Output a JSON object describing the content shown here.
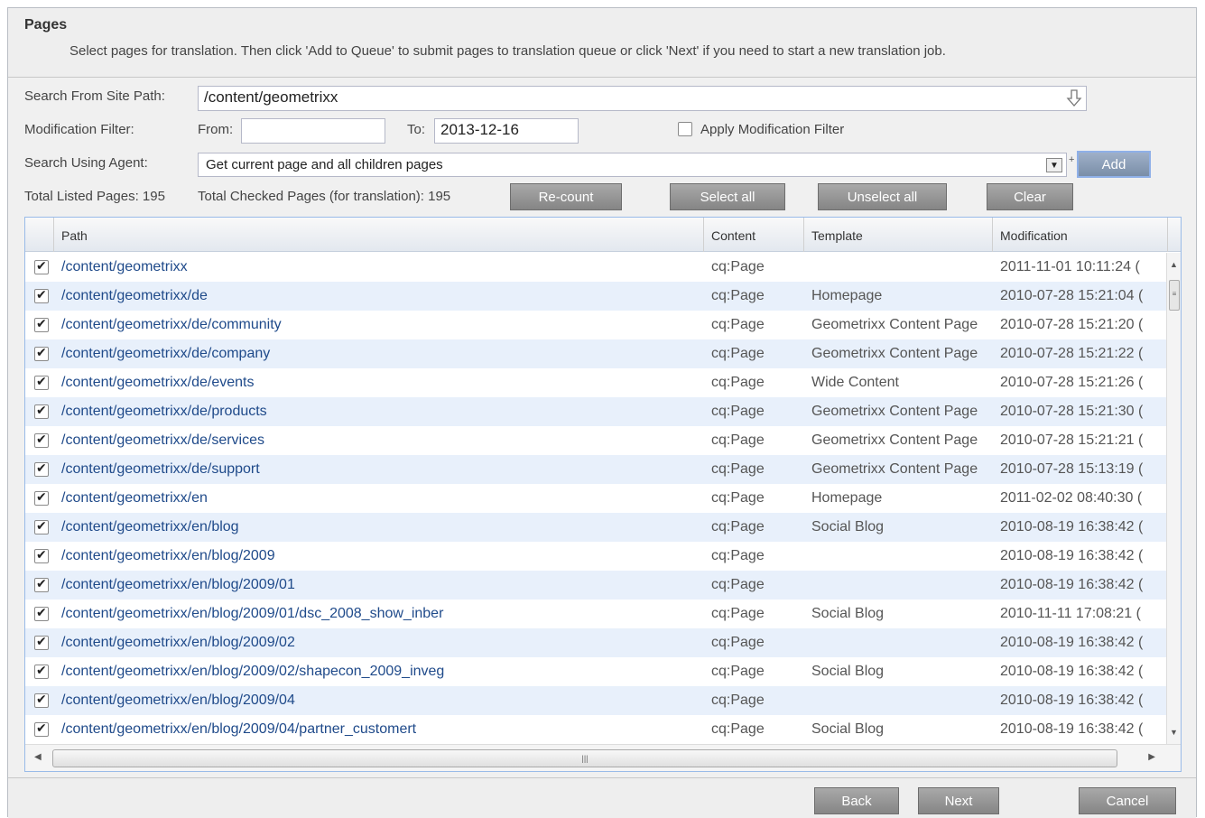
{
  "panel": {
    "title": "Pages",
    "description": "Select pages for translation. Then click 'Add to Queue' to submit pages to translation queue or click 'Next' if you need to start a new translation job."
  },
  "form": {
    "site_path_label": "Search From Site Path:",
    "site_path_value": "/content/geometrixx",
    "mod_filter_label": "Modification Filter:",
    "from_label": "From:",
    "from_value": "",
    "to_label": "To:",
    "to_value": "2013-12-16",
    "apply_filter_label": "Apply Modification Filter",
    "apply_filter_checked": false,
    "agent_label": "Search Using Agent:",
    "agent_value": "Get current page and all children pages",
    "add_label": "Add"
  },
  "summary": {
    "listed_text": "Total Listed Pages: 195",
    "checked_text": "Total Checked Pages (for translation): 195"
  },
  "actions": {
    "recount": "Re-count",
    "select_all": "Select all",
    "unselect_all": "Unselect all",
    "clear": "Clear"
  },
  "grid": {
    "columns": [
      "Path",
      "Content",
      "Template",
      "Modification"
    ],
    "rows": [
      {
        "path": "/content/geometrixx",
        "content": "cq:Page",
        "template": "",
        "modification": "2011-11-01 10:11:24 ("
      },
      {
        "path": "/content/geometrixx/de",
        "content": "cq:Page",
        "template": "Homepage",
        "modification": "2010-07-28 15:21:04 ("
      },
      {
        "path": "/content/geometrixx/de/community",
        "content": "cq:Page",
        "template": "Geometrixx Content Page",
        "modification": "2010-07-28 15:21:20 ("
      },
      {
        "path": "/content/geometrixx/de/company",
        "content": "cq:Page",
        "template": "Geometrixx Content Page",
        "modification": "2010-07-28 15:21:22 ("
      },
      {
        "path": "/content/geometrixx/de/events",
        "content": "cq:Page",
        "template": "Wide Content",
        "modification": "2010-07-28 15:21:26 ("
      },
      {
        "path": "/content/geometrixx/de/products",
        "content": "cq:Page",
        "template": "Geometrixx Content Page",
        "modification": "2010-07-28 15:21:30 ("
      },
      {
        "path": "/content/geometrixx/de/services",
        "content": "cq:Page",
        "template": "Geometrixx Content Page",
        "modification": "2010-07-28 15:21:21 ("
      },
      {
        "path": "/content/geometrixx/de/support",
        "content": "cq:Page",
        "template": "Geometrixx Content Page",
        "modification": "2010-07-28 15:13:19 ("
      },
      {
        "path": "/content/geometrixx/en",
        "content": "cq:Page",
        "template": "Homepage",
        "modification": "2011-02-02 08:40:30 ("
      },
      {
        "path": "/content/geometrixx/en/blog",
        "content": "cq:Page",
        "template": "Social Blog",
        "modification": "2010-08-19 16:38:42 ("
      },
      {
        "path": "/content/geometrixx/en/blog/2009",
        "content": "cq:Page",
        "template": "",
        "modification": "2010-08-19 16:38:42 ("
      },
      {
        "path": "/content/geometrixx/en/blog/2009/01",
        "content": "cq:Page",
        "template": "",
        "modification": "2010-08-19 16:38:42 ("
      },
      {
        "path": "/content/geometrixx/en/blog/2009/01/dsc_2008_show_inber",
        "content": "cq:Page",
        "template": "Social Blog",
        "modification": "2010-11-11 17:08:21 ("
      },
      {
        "path": "/content/geometrixx/en/blog/2009/02",
        "content": "cq:Page",
        "template": "",
        "modification": "2010-08-19 16:38:42 ("
      },
      {
        "path": "/content/geometrixx/en/blog/2009/02/shapecon_2009_inveg",
        "content": "cq:Page",
        "template": "Social Blog",
        "modification": "2010-08-19 16:38:42 ("
      },
      {
        "path": "/content/geometrixx/en/blog/2009/04",
        "content": "cq:Page",
        "template": "",
        "modification": "2010-08-19 16:38:42 ("
      },
      {
        "path": "/content/geometrixx/en/blog/2009/04/partner_customert",
        "content": "cq:Page",
        "template": "Social Blog",
        "modification": "2010-08-19 16:38:42 ("
      }
    ]
  },
  "footer": {
    "back": "Back",
    "next": "Next",
    "cancel": "Cancel"
  }
}
